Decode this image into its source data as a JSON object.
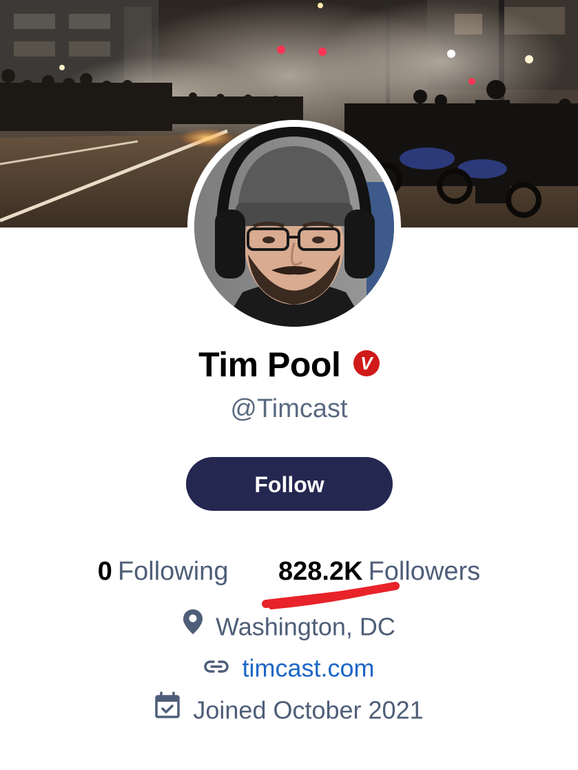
{
  "profile": {
    "display_name": "Tim Pool",
    "verified_badge": "V",
    "handle": "@Timcast"
  },
  "actions": {
    "follow_label": "Follow"
  },
  "stats": {
    "following_count": "0",
    "following_label": "Following",
    "followers_count": "828.2K",
    "followers_label": "Followers"
  },
  "meta": {
    "location": "Washington, DC",
    "location_icon": "map-pin-icon",
    "website": "timcast.com",
    "website_icon": "link-icon",
    "joined": "Joined October 2021",
    "joined_icon": "calendar-check-icon"
  },
  "colors": {
    "follow_button_bg": "#242750",
    "verified_badge_bg": "#d01a1a",
    "link_color": "#1c66c7",
    "secondary_text": "#4e5e78",
    "annotation_underline": "#e8232a"
  }
}
